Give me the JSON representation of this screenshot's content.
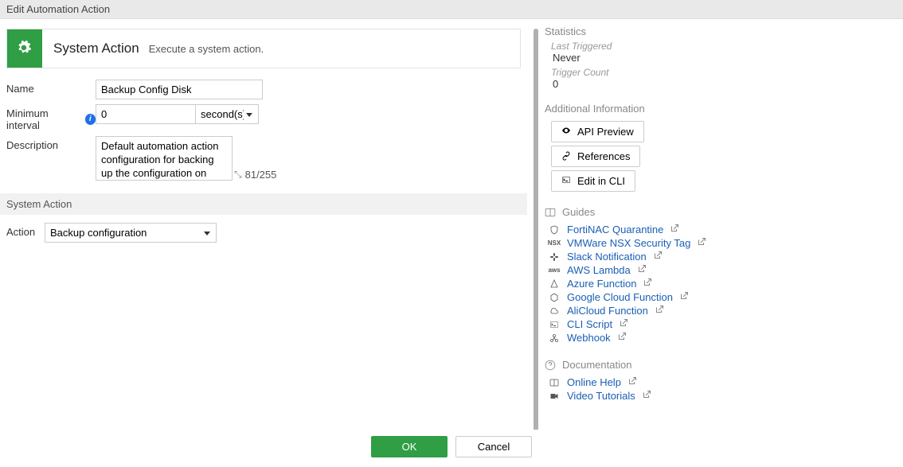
{
  "titlebar": "Edit Automation Action",
  "header": {
    "title": "System Action",
    "desc": "Execute a system action."
  },
  "form": {
    "name_label": "Name",
    "name_value": "Backup Config Disk",
    "min_label": "Minimum interval",
    "min_value": "0",
    "unit": "second(s)",
    "desc_label": "Description",
    "desc_value": "Default automation action configuration for backing up the configuration on disk.",
    "desc_count": "81/255"
  },
  "systemAction": {
    "section": "System Action",
    "action_label": "Action",
    "action_value": "Backup configuration"
  },
  "side": {
    "stats_header": "Statistics",
    "last_triggered_label": "Last Triggered",
    "last_triggered_value": "Never",
    "trigger_count_label": "Trigger Count",
    "trigger_count_value": "0",
    "addl_header": "Additional Information",
    "btn_api": "API Preview",
    "btn_refs": "References",
    "btn_cli": "Edit in CLI",
    "guides_header": "Guides",
    "guides": [
      "FortiNAC Quarantine",
      "VMWare NSX Security Tag",
      "Slack Notification",
      "AWS Lambda",
      "Azure Function",
      "Google Cloud Function",
      "AliCloud Function",
      "CLI Script",
      "Webhook"
    ],
    "docs_header": "Documentation",
    "docs": [
      "Online Help",
      "Video Tutorials"
    ]
  },
  "footer": {
    "ok": "OK",
    "cancel": "Cancel"
  }
}
